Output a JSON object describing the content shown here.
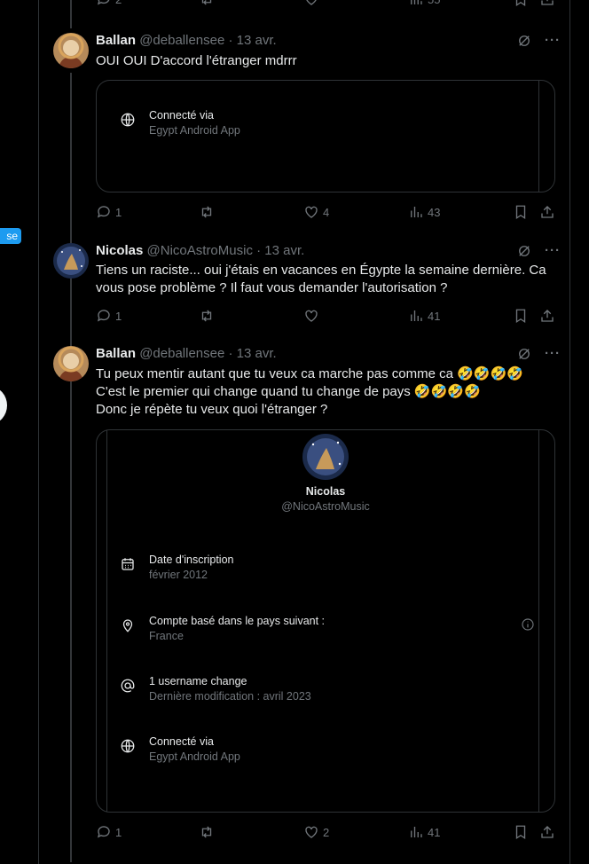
{
  "side": {
    "pill_text": "se"
  },
  "top_actions": {
    "replies": "2",
    "views": "55"
  },
  "tweets": [
    {
      "name": "Ballan",
      "handle": "@deballensee",
      "date": "· 13 avr.",
      "text": [
        "OUI OUI D'accord l'étranger mdrrr"
      ],
      "card": {
        "connected_label": "Connecté via",
        "connected_value": "Egypt Android App"
      },
      "actions": {
        "replies": "1",
        "retweets": "",
        "likes": "4",
        "views": "43"
      }
    },
    {
      "name": "Nicolas",
      "handle": "@NicoAstroMusic",
      "date": "· 13 avr.",
      "text": [
        "Tiens un raciste... oui j'étais en vacances en Égypte la semaine dernière. Ca",
        "vous pose problème ? Il faut vous demander l'autorisation ?"
      ],
      "actions": {
        "replies": "1",
        "retweets": "",
        "likes": "",
        "views": "41"
      }
    },
    {
      "name": "Ballan",
      "handle": "@deballensee",
      "date": "· 13 avr.",
      "text": [
        "Tu peux mentir autant que tu veux ca marche pas comme ca 🤣🤣🤣🤣",
        "C'est le premier qui change quand tu change de pays 🤣🤣🤣🤣",
        "Donc je répète tu veux quoi l'étranger ?"
      ],
      "card": {
        "profile_name": "Nicolas",
        "profile_handle": "@NicoAstroMusic",
        "rows": [
          {
            "icon": "calendar-icon",
            "label": "Date d'inscription",
            "value": "février 2012"
          },
          {
            "icon": "location-pin-icon",
            "label": "Compte basé dans le pays suivant :",
            "value": "France"
          },
          {
            "icon": "at-sign-icon",
            "label": "1 username change",
            "value": "Dernière modification : avril 2023"
          },
          {
            "icon": "globe-icon",
            "label": "Connecté via",
            "value": "Egypt Android App"
          }
        ]
      },
      "actions": {
        "replies": "1",
        "retweets": "",
        "likes": "2",
        "views": "41"
      }
    }
  ],
  "colors": {
    "background": "#000000",
    "text": "#e7e9ea",
    "muted": "#71767b",
    "border": "#2f3336",
    "accent": "#1d9bf0"
  }
}
